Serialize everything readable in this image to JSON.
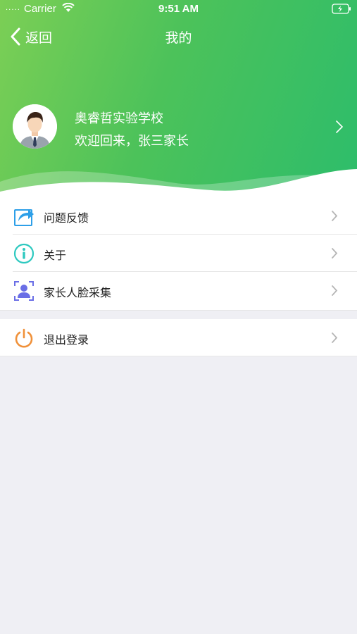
{
  "status_bar": {
    "signal": "·····",
    "carrier": "Carrier",
    "time": "9:51 AM"
  },
  "nav": {
    "back_label": "返回",
    "title": "我的"
  },
  "profile": {
    "school": "奥睿哲实验学校",
    "welcome": "欢迎回来，张三家长"
  },
  "menu": [
    {
      "label": "问题反馈",
      "icon": "share-arrow-icon"
    },
    {
      "label": "关于",
      "icon": "info-icon"
    },
    {
      "label": "家长人脸采集",
      "icon": "face-scan-icon"
    }
  ],
  "logout": {
    "label": "退出登录",
    "icon": "power-icon"
  },
  "colors": {
    "header_start": "#7ccf55",
    "header_end": "#2dbd6b",
    "feedback_icon": "#2d9fe8",
    "info_icon": "#2ec9c0",
    "face_icon": "#6a6ee6",
    "power_icon": "#f0913a",
    "background": "#efeff4"
  }
}
